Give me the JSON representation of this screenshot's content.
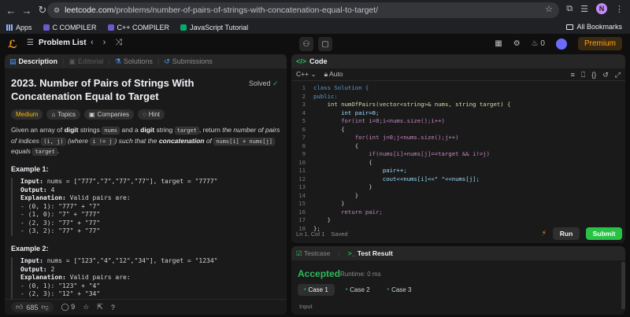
{
  "browser": {
    "url_host": "leetcode.com",
    "url_path": "/problems/number-of-pairs-of-strings-with-concatenation-equal-to-target/",
    "profile_initial": "N",
    "bookmarks": [
      "Apps",
      "C COMPILER",
      "C++ COMPILER",
      "JavaScript Tutorial"
    ],
    "all_bookmarks": "All Bookmarks"
  },
  "topbar": {
    "problem_list": "Problem List",
    "streak": "0",
    "premium": "Premium"
  },
  "left": {
    "tabs": [
      "Description",
      "Editorial",
      "Solutions",
      "Submissions"
    ],
    "title": "2023. Number of Pairs of Strings With Concatenation Equal to Target",
    "solved": "Solved",
    "chips": [
      "Medium",
      "Topics",
      "Companies",
      "Hint"
    ],
    "statement": {
      "s1": "Given an array of ",
      "s2": "digit",
      "s3": " strings ",
      "c1": "nums",
      "s4": " and a ",
      "s5": "digit",
      "s6": " string ",
      "c2": "target",
      "s7": ", return ",
      "s8": "the number of pairs of indices ",
      "c3": "(i, j)",
      "s9": " (where ",
      "c4": "i != j",
      "s10": ") such that the ",
      "s11": "concatenation",
      "s12": " of ",
      "c5": "nums[i] + nums[j]",
      "s13": " equals ",
      "c6": "target",
      "s14": "."
    },
    "example1": {
      "title": "Example 1:",
      "input_label": "Input:",
      "input": " nums = [\"777\",\"7\",\"77\",\"77\"], target = \"7777\"",
      "output_label": "Output:",
      "output": " 4",
      "expl_label": "Explanation:",
      "expl": " Valid pairs are:",
      "lines": [
        "- (0, 1): \"777\" + \"7\"",
        "- (1, 0): \"7\" + \"777\"",
        "- (2, 3): \"77\" + \"77\"",
        "- (3, 2): \"77\" + \"77\""
      ]
    },
    "example2": {
      "title": "Example 2:",
      "input_label": "Input:",
      "input": " nums = [\"123\",\"4\",\"12\",\"34\"], target = \"1234\"",
      "output_label": "Output:",
      "output": " 2",
      "expl_label": "Explanation:",
      "expl": " Valid pairs are:",
      "lines": [
        "- (0, 1): \"123\" + \"4\"",
        "- (2, 3): \"12\" + \"34\""
      ]
    },
    "footer": {
      "likes": "685",
      "comments": "9"
    }
  },
  "code": {
    "header": "Code",
    "language": "C++",
    "auto": "Auto",
    "status": "Ln 1, Col 1",
    "saved": "Saved",
    "run": "Run",
    "submit": "Submit",
    "lines": [
      "class Solution {",
      "public:",
      "    int numOfPairs(vector<string>& nums, string target) {",
      "        int pair=0;",
      "        for(int i=0;i<nums.size();i++)",
      "        {",
      "            for(int j=0;j<nums.size();j++)",
      "            {",
      "                if(nums[i]+nums[j]==target && i!=j)",
      "                {",
      "                    pair++;",
      "                    cout<<nums[i]<<\" \"<<nums[j];",
      "                }",
      "            }",
      "        }",
      "        return pair;",
      "    }",
      "};"
    ]
  },
  "test": {
    "tab_testcase": "Testcase",
    "tab_result": "Test Result",
    "verdict": "Accepted",
    "runtime": "Runtime: 0 ms",
    "cases": [
      "Case 1",
      "Case 2",
      "Case 3"
    ],
    "input_label": "Input"
  },
  "colors": {
    "accent": "#ffa116",
    "green": "#2cbb5d",
    "submit": "#28c244",
    "panel": "#1a1a1a"
  }
}
